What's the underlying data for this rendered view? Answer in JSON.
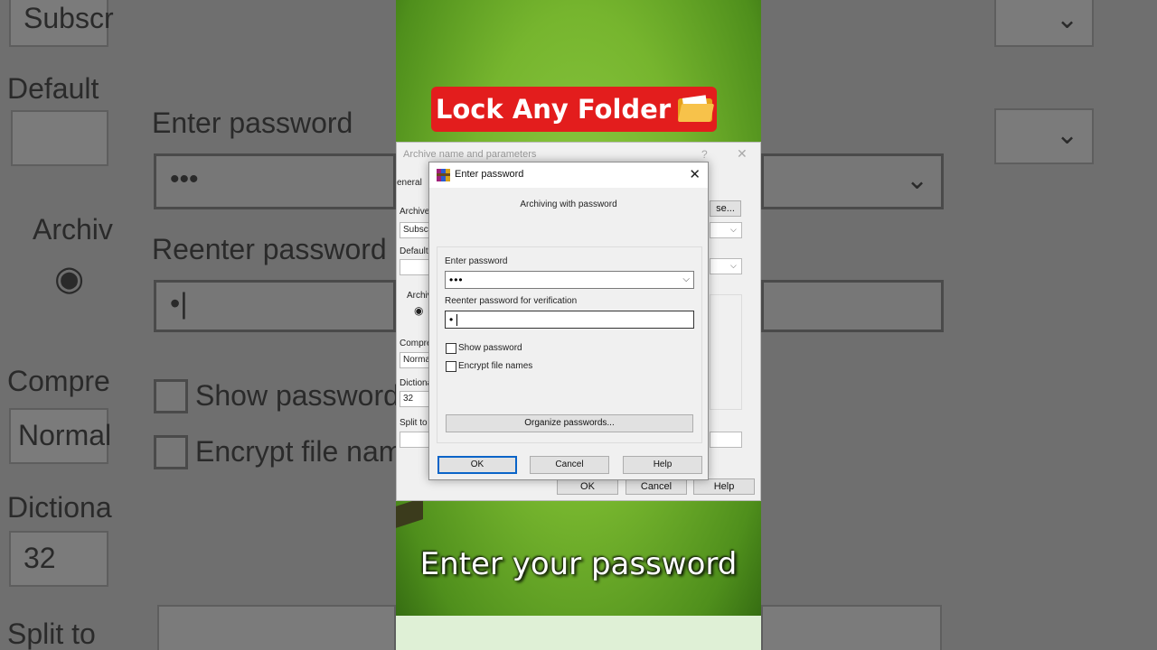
{
  "video": {
    "title_banner": "Lock Any Folder",
    "banner_icon": "open-folder-icon",
    "caption": "Enter your password"
  },
  "background_zoom": {
    "texts": [
      "Subscr",
      "Default",
      "Enter password",
      "•••",
      "Archiv",
      "Reenter password",
      "•|",
      "Compre",
      "Show password",
      "Normal",
      "Encrypt file nam",
      "Dictiona",
      "32",
      "Split to"
    ]
  },
  "archive_dialog": {
    "title": "Archive name and parameters",
    "help_glyph": "?",
    "close_glyph": "✕",
    "tab_general": "eneral",
    "archive_label": "Archive",
    "archive_value": "Subscr",
    "browse_label": "se...",
    "default_label": "Default",
    "archive_format_label": "Archiv",
    "compression_label": "Compre",
    "compression_value": "Normal",
    "dictionary_label": "Dictiona",
    "dictionary_value": "32",
    "split_label": "Split to",
    "ok": "OK",
    "cancel": "Cancel",
    "help": "Help"
  },
  "password_dialog": {
    "title": "Enter password",
    "subtitle": "Archiving with password",
    "enter_label": "Enter password",
    "enter_value": "•••",
    "reenter_label": "Reenter password for verification",
    "reenter_value": "•",
    "show_password": "Show password",
    "encrypt_names": "Encrypt file names",
    "organize": "Organize passwords...",
    "ok": "OK",
    "cancel": "Cancel",
    "help": "Help"
  }
}
